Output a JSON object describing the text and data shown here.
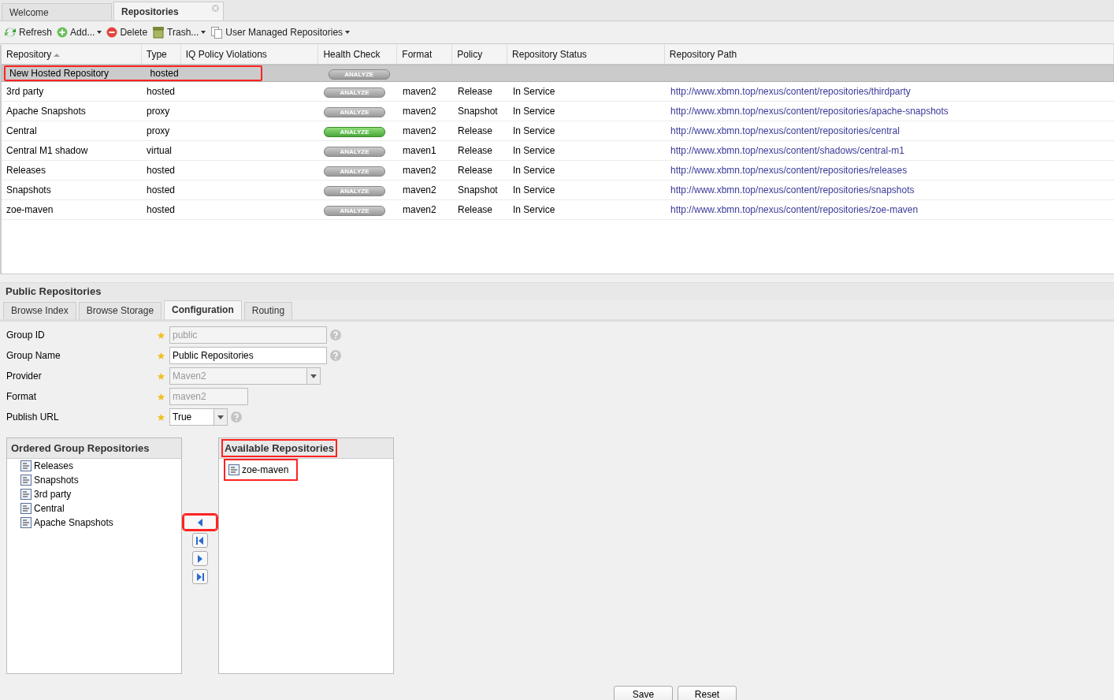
{
  "tabs": [
    {
      "label": "Welcome",
      "selected": false,
      "closable": false
    },
    {
      "label": "Repositories",
      "selected": true,
      "closable": true
    }
  ],
  "toolbar": [
    {
      "kind": "refresh",
      "label": "Refresh",
      "menu": false
    },
    {
      "kind": "add",
      "label": "Add...",
      "menu": true
    },
    {
      "kind": "delete",
      "label": "Delete",
      "menu": false
    },
    {
      "kind": "trash",
      "label": "Trash...",
      "menu": true
    },
    {
      "kind": "copy",
      "label": "User Managed Repositories",
      "menu": true
    }
  ],
  "table": {
    "columns": [
      {
        "label": "Repository",
        "sorted": true
      },
      {
        "label": "Type",
        "sorted": false
      },
      {
        "label": "IQ Policy Violations",
        "sorted": false
      },
      {
        "label": "Health Check",
        "sorted": false
      },
      {
        "label": "Format",
        "sorted": false
      },
      {
        "label": "Policy",
        "sorted": false
      },
      {
        "label": "Repository Status",
        "sorted": false
      },
      {
        "label": "Repository Path",
        "sorted": false
      }
    ],
    "rows": [
      {
        "name": "New Hosted Repository",
        "type": "hosted",
        "analyze": "ANALYZE",
        "enabled": false,
        "format": "",
        "policy": "",
        "status": "",
        "path": "",
        "selected": true,
        "highlighted": true
      },
      {
        "name": "3rd party",
        "type": "hosted",
        "analyze": "ANALYZE",
        "enabled": false,
        "format": "maven2",
        "policy": "Release",
        "status": "In Service",
        "path": "http://www.xbmn.top/nexus/content/repositories/thirdparty",
        "selected": false,
        "highlighted": false
      },
      {
        "name": "Apache Snapshots",
        "type": "proxy",
        "analyze": "ANALYZE",
        "enabled": false,
        "format": "maven2",
        "policy": "Snapshot",
        "status": "In Service",
        "path": "http://www.xbmn.top/nexus/content/repositories/apache-snapshots",
        "selected": false,
        "highlighted": false
      },
      {
        "name": "Central",
        "type": "proxy",
        "analyze": "ANALYZE",
        "enabled": true,
        "format": "maven2",
        "policy": "Release",
        "status": "In Service",
        "path": "http://www.xbmn.top/nexus/content/repositories/central",
        "selected": false,
        "highlighted": false
      },
      {
        "name": "Central M1 shadow",
        "type": "virtual",
        "analyze": "ANALYZE",
        "enabled": false,
        "format": "maven1",
        "policy": "Release",
        "status": "In Service",
        "path": "http://www.xbmn.top/nexus/content/shadows/central-m1",
        "selected": false,
        "highlighted": false
      },
      {
        "name": "Releases",
        "type": "hosted",
        "analyze": "ANALYZE",
        "enabled": false,
        "format": "maven2",
        "policy": "Release",
        "status": "In Service",
        "path": "http://www.xbmn.top/nexus/content/repositories/releases",
        "selected": false,
        "highlighted": false
      },
      {
        "name": "Snapshots",
        "type": "hosted",
        "analyze": "ANALYZE",
        "enabled": false,
        "format": "maven2",
        "policy": "Snapshot",
        "status": "In Service",
        "path": "http://www.xbmn.top/nexus/content/repositories/snapshots",
        "selected": false,
        "highlighted": false
      },
      {
        "name": "zoe-maven",
        "type": "hosted",
        "analyze": "ANALYZE",
        "enabled": false,
        "format": "maven2",
        "policy": "Release",
        "status": "In Service",
        "path": "http://www.xbmn.top/nexus/content/repositories/zoe-maven",
        "selected": false,
        "highlighted": false
      }
    ]
  },
  "panel": {
    "title": "Public Repositories",
    "tabs": [
      {
        "label": "Browse Index",
        "selected": false
      },
      {
        "label": "Browse Storage",
        "selected": false
      },
      {
        "label": "Configuration",
        "selected": true
      },
      {
        "label": "Routing",
        "selected": false
      }
    ],
    "fields": [
      {
        "kind": "text",
        "label": "Group ID",
        "value": "public",
        "disabled": true,
        "help": true
      },
      {
        "kind": "text",
        "label": "Group Name",
        "value": "Public Repositories",
        "disabled": false,
        "help": true
      },
      {
        "kind": "select",
        "label": "Provider",
        "value": "Maven2",
        "disabled": true,
        "help": false
      },
      {
        "kind": "short",
        "label": "Format",
        "value": "maven2",
        "disabled": true,
        "help": false
      },
      {
        "kind": "smallselect",
        "label": "Publish URL",
        "value": "True",
        "disabled": false,
        "help": true
      }
    ],
    "ordered": {
      "title": "Ordered Group Repositories",
      "items": [
        "Releases",
        "Snapshots",
        "3rd party",
        "Central",
        "Apache Snapshots"
      ]
    },
    "available": {
      "title": "Available Repositories",
      "highlighted": true,
      "items": [
        {
          "label": "zoe-maven",
          "highlighted": true
        }
      ]
    },
    "moves": [
      {
        "kind": "left",
        "highlighted": true
      },
      {
        "kind": "first",
        "highlighted": false
      },
      {
        "kind": "right",
        "highlighted": false
      },
      {
        "kind": "last",
        "highlighted": false
      }
    ],
    "buttons": [
      "Save",
      "Reset"
    ]
  }
}
